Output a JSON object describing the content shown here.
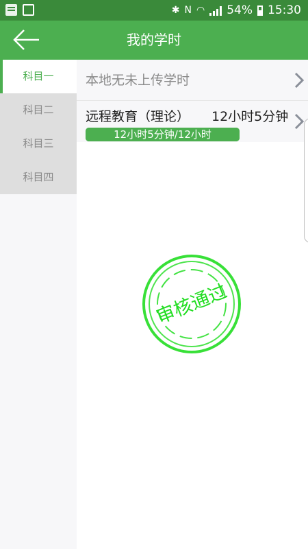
{
  "status_bar": {
    "battery": "54%",
    "time": "15:30",
    "icons": [
      "grid-notification-icon",
      "check-notification-icon",
      "bluetooth-icon",
      "nfc-icon",
      "wifi-icon",
      "signal-icon",
      "battery-icon"
    ]
  },
  "header": {
    "title": "我的学时",
    "back_icon": "arrow-left-icon"
  },
  "sidebar": {
    "items": [
      {
        "label": "科目一",
        "active": true
      },
      {
        "label": "科目二",
        "active": false
      },
      {
        "label": "科目三",
        "active": false
      },
      {
        "label": "科目四",
        "active": false
      }
    ]
  },
  "main": {
    "local_row": {
      "label": "本地无未上传学时"
    },
    "course": {
      "name": "远程教育（理论）",
      "hours": "12小时5分钟",
      "progress_label": "12小时5分钟/12小时",
      "progress_percent": 100
    },
    "stamp_text": "审核通过"
  },
  "colors": {
    "primary": "#4caf50",
    "status_bar": "#3a8a3a",
    "stamp": "#22dd22"
  }
}
